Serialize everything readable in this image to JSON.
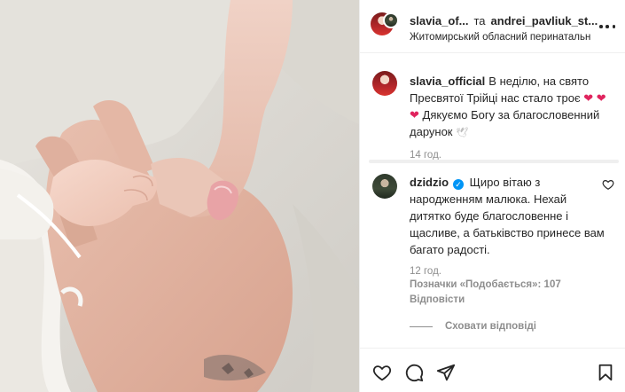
{
  "post": {
    "author": "slavia_of...",
    "coauthor": "andrei_pavliuk_st...",
    "separator": "та",
    "location": "Житомирський обласний перинатальний центр"
  },
  "caption": {
    "username": "slavia_official",
    "text_part1": "В неділю, на свято Пресвятої Трійці нас стало троє",
    "text_part2": "Дякуємо Богу за благословенний дарунок",
    "heart_glyph": "❤",
    "dove_glyph": "🕊",
    "time": "14 год."
  },
  "comment": {
    "username": "dzidzio",
    "verified_glyph": "✓",
    "text": "Щиро вітаю з народженням малюка. Нехай дитятко буде благословенне і щасливе, а батьківство принесе вам багато радості.",
    "time": "12 год.",
    "likes": "Позначки «Подобається»: 107",
    "reply": "Відповісти",
    "hide_replies": "Сховати відповіді"
  },
  "icons": {
    "more": "more-horizontal-icon",
    "like": "heart-outline-icon",
    "comment": "comment-bubble-icon",
    "share": "paper-plane-icon",
    "save": "bookmark-icon",
    "comment_like": "heart-small-icon"
  },
  "colors": {
    "heart_red": "#e0245e",
    "verified_blue": "#0095f6",
    "muted_text": "#8e8e8e"
  }
}
